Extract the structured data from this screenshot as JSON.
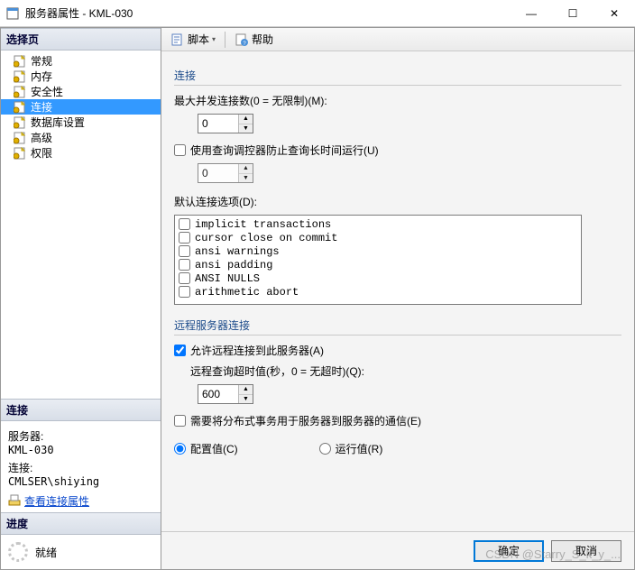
{
  "window": {
    "title": "服务器属性 - KML-030",
    "minimize": "—",
    "maximize": "☐",
    "close": "✕"
  },
  "sidebar": {
    "select_page_header": "选择页",
    "items": [
      {
        "label": "常规",
        "key": "general"
      },
      {
        "label": "内存",
        "key": "memory"
      },
      {
        "label": "安全性",
        "key": "security"
      },
      {
        "label": "连接",
        "key": "connections",
        "selected": true
      },
      {
        "label": "数据库设置",
        "key": "database"
      },
      {
        "label": "高级",
        "key": "advanced"
      },
      {
        "label": "权限",
        "key": "permissions"
      }
    ],
    "connection_header": "连接",
    "server_label": "服务器:",
    "server_value": "KML-030",
    "conn_label": "连接:",
    "conn_value": "CMLSER\\shiying",
    "view_props": "查看连接属性",
    "progress_header": "进度",
    "ready": "就绪"
  },
  "toolbar": {
    "script": "脚本",
    "help": "帮助"
  },
  "form": {
    "conn_group": "连接",
    "max_conn_label": "最大并发连接数(0 = 无限制)(M):",
    "max_conn_value": "0",
    "use_query_gov": "使用查询调控器防止查询长时间运行(U)",
    "gov_value": "0",
    "default_opts_label": "默认连接选项(D):",
    "options": [
      "implicit transactions",
      "cursor close on commit",
      "ansi warnings",
      "ansi padding",
      "ANSI NULLS",
      "arithmetic abort"
    ],
    "remote_group": "远程服务器连接",
    "allow_remote": "允许远程连接到此服务器(A)",
    "allow_remote_checked": true,
    "remote_timeout_label": "远程查询超时值(秒，0 = 无超时)(Q):",
    "remote_timeout_value": "600",
    "dist_trans": "需要将分布式事务用于服务器到服务器的通信(E)",
    "radio_config": "配置值(C)",
    "radio_running": "运行值(R)"
  },
  "footer": {
    "ok": "确定",
    "cancel": "取消"
  },
  "watermark": "CSDN @Starry_S_k_y_..."
}
